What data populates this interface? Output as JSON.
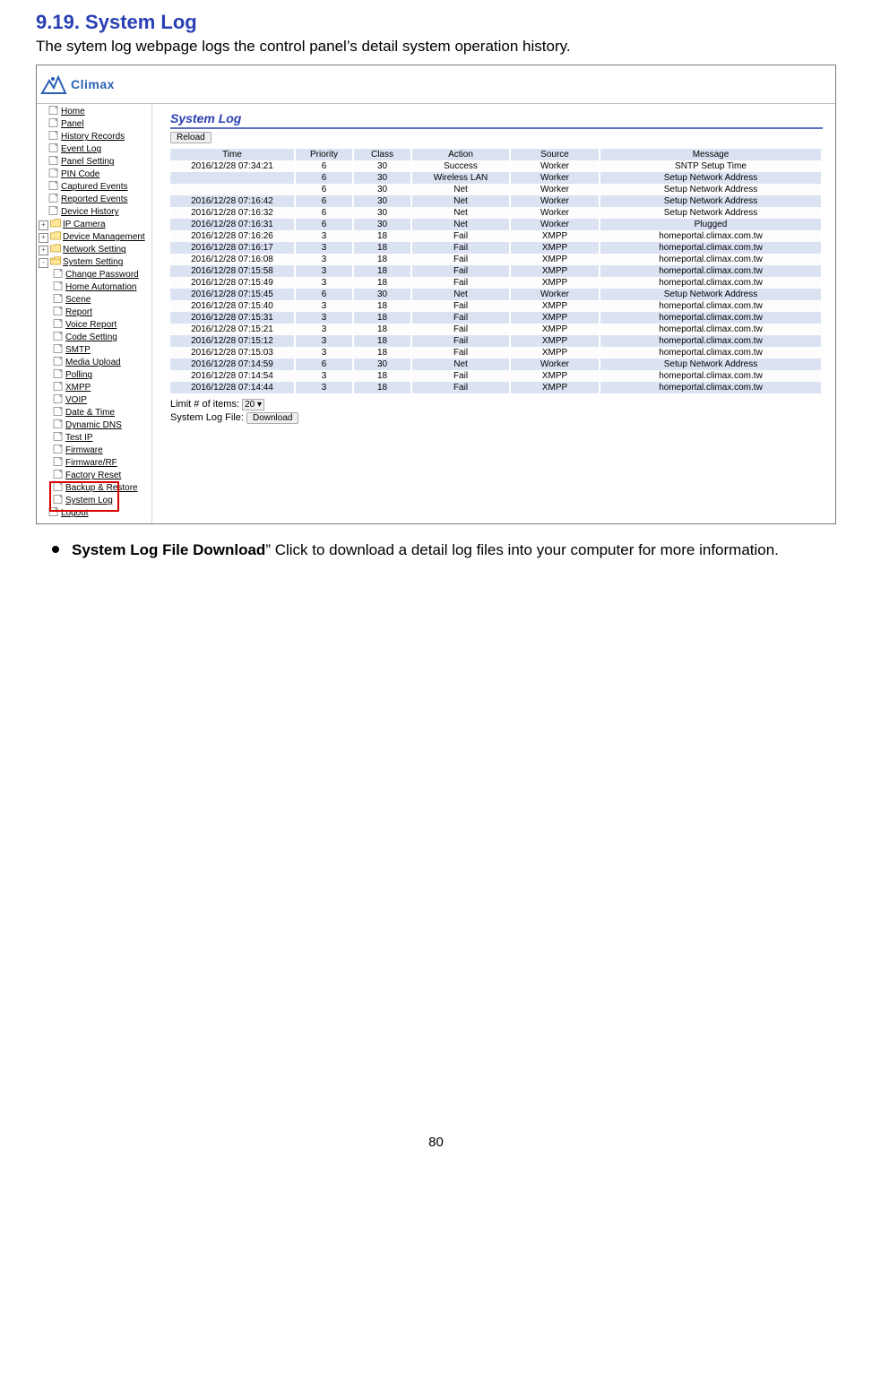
{
  "heading": "9.19. System Log",
  "intro": "The sytem log webpage logs the control panel’s detail system operation history.",
  "brand": "Climax",
  "sidebar": [
    {
      "label": "Home",
      "icon": "file",
      "indent": 0,
      "exp": null
    },
    {
      "label": "Panel",
      "icon": "file",
      "indent": 0,
      "exp": null
    },
    {
      "label": "History Records",
      "icon": "file",
      "indent": 0,
      "exp": null
    },
    {
      "label": "Event Log",
      "icon": "file",
      "indent": 0,
      "exp": null
    },
    {
      "label": "Panel Setting",
      "icon": "file",
      "indent": 0,
      "exp": null
    },
    {
      "label": "PIN Code",
      "icon": "file",
      "indent": 0,
      "exp": null
    },
    {
      "label": "Captured Events",
      "icon": "file",
      "indent": 0,
      "exp": null
    },
    {
      "label": "Reported Events",
      "icon": "file",
      "indent": 0,
      "exp": null
    },
    {
      "label": "Device History",
      "icon": "file",
      "indent": 0,
      "exp": null
    },
    {
      "label": "IP Camera",
      "icon": "folder",
      "indent": 0,
      "exp": "+"
    },
    {
      "label": "Device Management",
      "icon": "folder",
      "indent": 0,
      "exp": "+"
    },
    {
      "label": "Network Setting",
      "icon": "folder",
      "indent": 0,
      "exp": "+"
    },
    {
      "label": "System Setting",
      "icon": "folder-open",
      "indent": 0,
      "exp": "-"
    },
    {
      "label": "Change Password",
      "icon": "file",
      "indent": 1,
      "exp": null
    },
    {
      "label": "Home Automation",
      "icon": "file",
      "indent": 1,
      "exp": null
    },
    {
      "label": "Scene",
      "icon": "file",
      "indent": 1,
      "exp": null
    },
    {
      "label": "Report",
      "icon": "file",
      "indent": 1,
      "exp": null
    },
    {
      "label": "Voice Report",
      "icon": "file",
      "indent": 1,
      "exp": null
    },
    {
      "label": "Code Setting",
      "icon": "file",
      "indent": 1,
      "exp": null
    },
    {
      "label": "SMTP",
      "icon": "file",
      "indent": 1,
      "exp": null
    },
    {
      "label": "Media Upload",
      "icon": "file",
      "indent": 1,
      "exp": null
    },
    {
      "label": "Polling",
      "icon": "file",
      "indent": 1,
      "exp": null
    },
    {
      "label": "XMPP",
      "icon": "file",
      "indent": 1,
      "exp": null
    },
    {
      "label": "VOIP",
      "icon": "file",
      "indent": 1,
      "exp": null
    },
    {
      "label": "Date & Time",
      "icon": "file",
      "indent": 1,
      "exp": null
    },
    {
      "label": "Dynamic DNS",
      "icon": "file",
      "indent": 1,
      "exp": null
    },
    {
      "label": "Test IP",
      "icon": "file",
      "indent": 1,
      "exp": null
    },
    {
      "label": "Firmware",
      "icon": "file",
      "indent": 1,
      "exp": null
    },
    {
      "label": "Firmware/RF",
      "icon": "file",
      "indent": 1,
      "exp": null
    },
    {
      "label": "Factory Reset",
      "icon": "file",
      "indent": 1,
      "exp": null
    },
    {
      "label": "Backup & Restore",
      "icon": "file",
      "indent": 1,
      "exp": null,
      "highlight": true,
      "suffix": "re"
    },
    {
      "label": "System Log",
      "icon": "file",
      "indent": 1,
      "exp": null,
      "highlight": true
    },
    {
      "label": "Logout",
      "icon": "file",
      "indent": 0,
      "exp": null
    }
  ],
  "main": {
    "title": "System Log",
    "reload": "Reload",
    "headers": [
      "Time",
      "Priority",
      "Class",
      "Action",
      "Source",
      "Message"
    ],
    "rows": [
      [
        "2016/12/28 07:34:21",
        "6",
        "30",
        "Success",
        "Worker",
        "SNTP Setup Time"
      ],
      [
        "",
        "6",
        "30",
        "Wireless LAN",
        "Worker",
        "Setup Network Address"
      ],
      [
        "",
        "6",
        "30",
        "Net",
        "Worker",
        "Setup Network Address"
      ],
      [
        "2016/12/28 07:16:42",
        "6",
        "30",
        "Net",
        "Worker",
        "Setup Network Address"
      ],
      [
        "2016/12/28 07:16:32",
        "6",
        "30",
        "Net",
        "Worker",
        "Setup Network Address"
      ],
      [
        "2016/12/28 07:16:31",
        "6",
        "30",
        "Net",
        "Worker",
        "Plugged"
      ],
      [
        "2016/12/28 07:16:26",
        "3",
        "18",
        "Fail",
        "XMPP",
        "homeportal.climax.com.tw"
      ],
      [
        "2016/12/28 07:16:17",
        "3",
        "18",
        "Fail",
        "XMPP",
        "homeportal.climax.com.tw"
      ],
      [
        "2016/12/28 07:16:08",
        "3",
        "18",
        "Fail",
        "XMPP",
        "homeportal.climax.com.tw"
      ],
      [
        "2016/12/28 07:15:58",
        "3",
        "18",
        "Fail",
        "XMPP",
        "homeportal.climax.com.tw"
      ],
      [
        "2016/12/28 07:15:49",
        "3",
        "18",
        "Fail",
        "XMPP",
        "homeportal.climax.com.tw"
      ],
      [
        "2016/12/28 07:15:45",
        "6",
        "30",
        "Net",
        "Worker",
        "Setup Network Address"
      ],
      [
        "2016/12/28 07:15:40",
        "3",
        "18",
        "Fail",
        "XMPP",
        "homeportal.climax.com.tw"
      ],
      [
        "2016/12/28 07:15:31",
        "3",
        "18",
        "Fail",
        "XMPP",
        "homeportal.climax.com.tw"
      ],
      [
        "2016/12/28 07:15:21",
        "3",
        "18",
        "Fail",
        "XMPP",
        "homeportal.climax.com.tw"
      ],
      [
        "2016/12/28 07:15:12",
        "3",
        "18",
        "Fail",
        "XMPP",
        "homeportal.climax.com.tw"
      ],
      [
        "2016/12/28 07:15:03",
        "3",
        "18",
        "Fail",
        "XMPP",
        "homeportal.climax.com.tw"
      ],
      [
        "2016/12/28 07:14:59",
        "6",
        "30",
        "Net",
        "Worker",
        "Setup Network Address"
      ],
      [
        "2016/12/28 07:14:54",
        "3",
        "18",
        "Fail",
        "XMPP",
        "homeportal.climax.com.tw"
      ],
      [
        "2016/12/28 07:14:44",
        "3",
        "18",
        "Fail",
        "XMPP",
        "homeportal.climax.com.tw"
      ]
    ],
    "limit_label": "Limit # of items:",
    "limit_value": "20",
    "download_label": "System Log File:",
    "download_btn": "Download"
  },
  "bullet": {
    "bold": "System Log File Download",
    "rest": "” Click to download a detail log files into your computer for more information."
  },
  "page_num": "80"
}
